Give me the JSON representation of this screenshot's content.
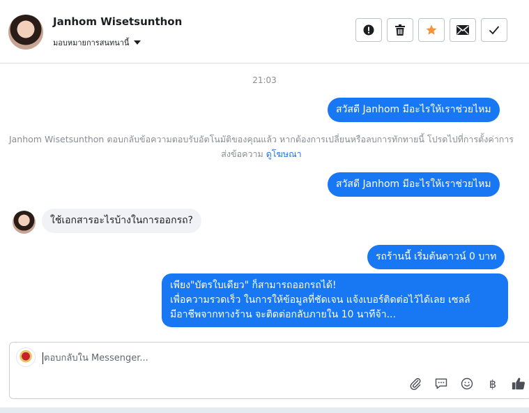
{
  "header": {
    "contact_name": "Janhom Wisetsunthon",
    "assign_label": "มอบหมายการสนทนานี้",
    "actions": [
      {
        "name": "report-button",
        "icon": "exclamation-circle-icon"
      },
      {
        "name": "delete-button",
        "icon": "trash-icon"
      },
      {
        "name": "star-button",
        "icon": "star-icon",
        "color": "#f7923b"
      },
      {
        "name": "email-button",
        "icon": "envelope-icon"
      },
      {
        "name": "done-button",
        "icon": "checkmark-icon"
      }
    ]
  },
  "conversation": {
    "timestamp": "21:03",
    "greeting_1": "สวัสดี Janhom มีอะไรให้เราช่วยไหม",
    "notice_text": "Janhom Wisetsunthon ตอบกลับข้อความตอบรับอัตโนมัติของคุณแล้ว หากต้องการเปลี่ยนหรือลบการทักทายนี้ โปรดไปที่การตั้งค่าการส่งข้อความ",
    "notice_link": "ดูโฆษณา",
    "greeting_2": "สวัสดี Janhom มีอะไรให้เราช่วยไหม",
    "incoming_question": "ใช้เอกสารอะไรบ้างในการออกรถ?",
    "reply_price": "รถร้านนี้ เริ่มต้นดาวน์ 0 บาท",
    "reply_long": [
      "เพียง\"บัตรใบเดียว\" ก็สามารถออกรถได้!",
      "เพื่อความรวดเร็ว ในการให้ข้อมูลที่ชัดเจน แจ้งเบอร์ติดต่อไว้ได้เลย เซลล์",
      "มีอาชีพจากทางร้าน จะติดต่อกลับภายใน 10 นาทีจ้า..."
    ]
  },
  "composer": {
    "placeholder": "ตอบกลับใน Messenger...",
    "tools": [
      {
        "name": "attach-button",
        "icon": "paperclip-icon"
      },
      {
        "name": "saved-replies-button",
        "icon": "speech-bubble-icon"
      },
      {
        "name": "emoji-button",
        "icon": "smiley-icon"
      },
      {
        "name": "payment-button",
        "icon": "baht-icon",
        "glyph": "฿"
      },
      {
        "name": "like-button",
        "icon": "thumbs-up-icon"
      }
    ]
  },
  "colors": {
    "accent": "#1877f2",
    "incoming_bg": "#f0f2f5",
    "muted_text": "#8a8d91",
    "star": "#f7923b"
  }
}
